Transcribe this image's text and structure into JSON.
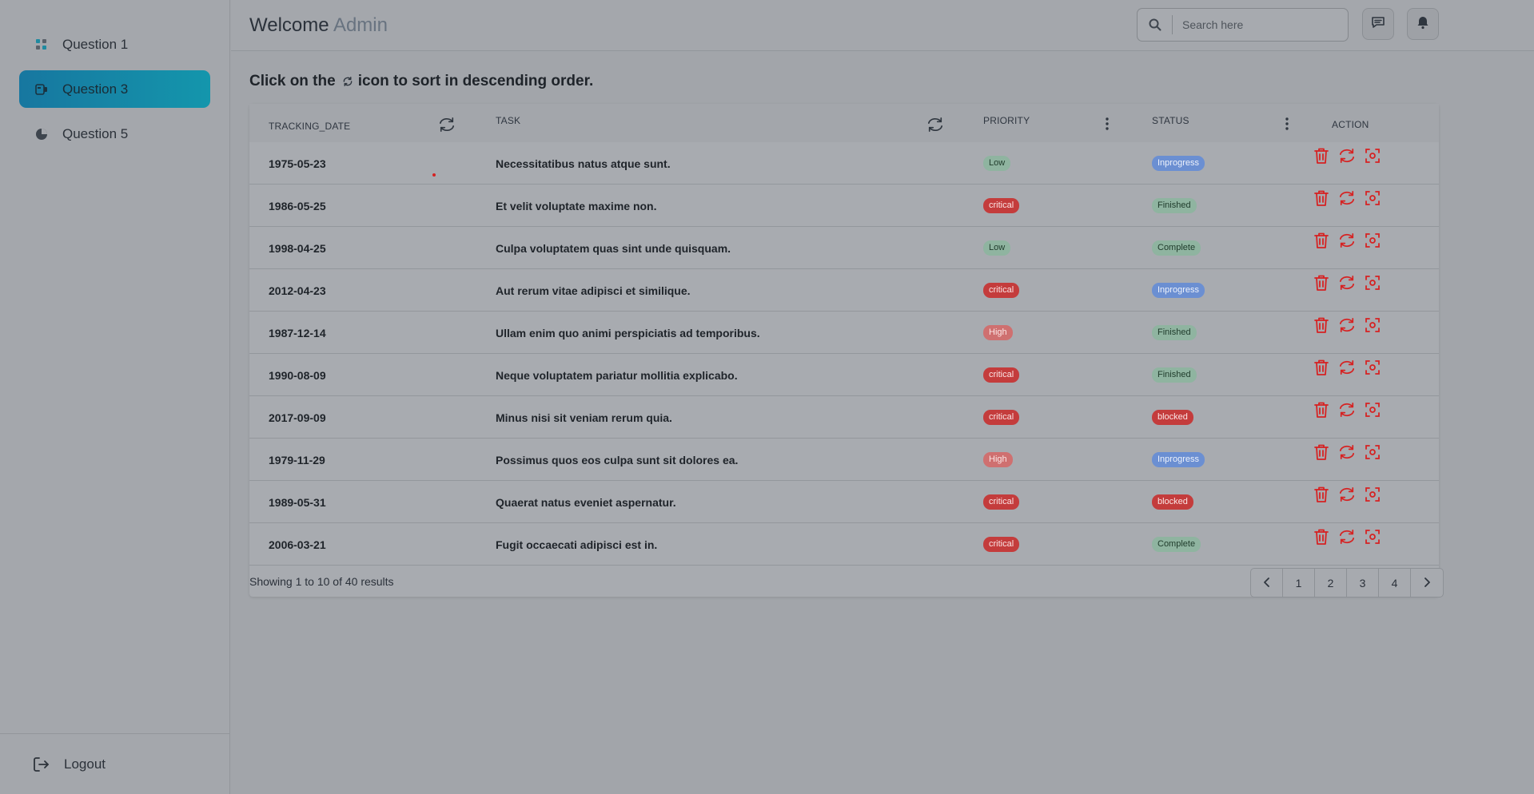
{
  "sidebar": {
    "items": [
      {
        "label": "Question 1",
        "icon": "grid-icon",
        "active": false
      },
      {
        "label": "Question 3",
        "icon": "camera-icon",
        "active": true
      },
      {
        "label": "Question 5",
        "icon": "pie-chart-icon",
        "active": false
      }
    ],
    "logout_label": "Logout"
  },
  "header": {
    "welcome": "Welcome",
    "user": "Admin",
    "search_placeholder": "Search here"
  },
  "instruction": {
    "before": "Click on the",
    "after": "icon to sort in descending order."
  },
  "table": {
    "columns": {
      "tracking_date": "TRACKING_DATE",
      "task": "TASK",
      "priority": "PRIORITY",
      "status": "STATUS",
      "action": "ACTION"
    },
    "rows": [
      {
        "date": "1975-05-23",
        "task": "Necessitatibus natus atque sunt.",
        "priority": "Low",
        "status": "Inprogress"
      },
      {
        "date": "1986-05-25",
        "task": "Et velit voluptate maxime non.",
        "priority": "critical",
        "status": "Finished"
      },
      {
        "date": "1998-04-25",
        "task": "Culpa voluptatem quas sint unde quisquam.",
        "priority": "Low",
        "status": "Complete"
      },
      {
        "date": "2012-04-23",
        "task": "Aut rerum vitae adipisci et similique.",
        "priority": "critical",
        "status": "Inprogress"
      },
      {
        "date": "1987-12-14",
        "task": "Ullam enim quo animi perspiciatis ad temporibus.",
        "priority": "High",
        "status": "Finished"
      },
      {
        "date": "1990-08-09",
        "task": "Neque voluptatem pariatur mollitia explicabo.",
        "priority": "critical",
        "status": "Finished"
      },
      {
        "date": "2017-09-09",
        "task": "Minus nisi sit veniam rerum quia.",
        "priority": "critical",
        "status": "blocked"
      },
      {
        "date": "1979-11-29",
        "task": "Possimus quos eos culpa sunt sit dolores ea.",
        "priority": "High",
        "status": "Inprogress"
      },
      {
        "date": "1989-05-31",
        "task": "Quaerat natus eveniet aspernatur.",
        "priority": "critical",
        "status": "blocked"
      },
      {
        "date": "2006-03-21",
        "task": "Fugit occaecati adipisci est in.",
        "priority": "critical",
        "status": "Complete"
      }
    ]
  },
  "footer": {
    "results_text": "Showing 1 to 10 of 40 results",
    "pages": [
      "1",
      "2",
      "3",
      "4"
    ]
  },
  "colors": {
    "accent": "#1496ac",
    "danger": "#d62222"
  }
}
